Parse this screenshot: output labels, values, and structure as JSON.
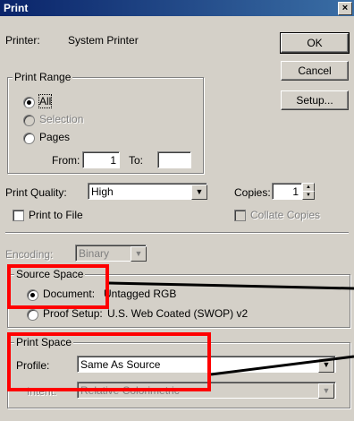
{
  "window": {
    "title": "Print",
    "close_glyph": "×"
  },
  "printer": {
    "label": "Printer:",
    "value": "System Printer"
  },
  "buttons": {
    "ok": "OK",
    "cancel": "Cancel",
    "setup": "Setup..."
  },
  "print_range": {
    "legend": "Print Range",
    "all": "All",
    "selection": "Selection",
    "pages": "Pages",
    "from_label": "From:",
    "from_value": "1",
    "to_label": "To:",
    "to_value": ""
  },
  "quality": {
    "label": "Print Quality:",
    "value": "High"
  },
  "copies": {
    "label": "Copies:",
    "value": "1"
  },
  "print_to_file": "Print to File",
  "collate": "Collate Copies",
  "encoding": {
    "label": "Encoding:",
    "value": "Binary"
  },
  "source_space": {
    "legend": "Source Space",
    "document_label": "Document:",
    "document_value": "Untagged RGB",
    "proof_label": "Proof Setup:",
    "proof_value": "U.S. Web Coated (SWOP) v2"
  },
  "print_space": {
    "legend": "Print Space",
    "profile_label": "Profile:",
    "profile_value": "Same As Source",
    "intent_label": "Intent:",
    "intent_value": "Relative Colorimetric"
  },
  "colors": {
    "annotation_red": "#ff0000",
    "title_blue": "#0a246a"
  }
}
